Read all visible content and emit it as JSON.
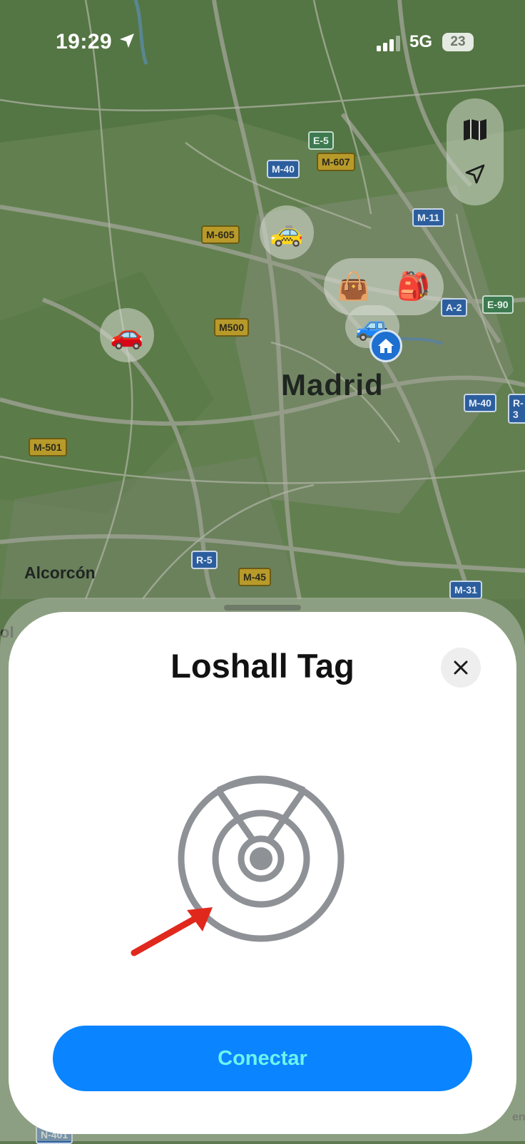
{
  "status_bar": {
    "time": "19:29",
    "network": "5G",
    "battery": "23",
    "location_icon": "location-arrow-icon",
    "signal_icon": "cellular-signal-icon"
  },
  "map": {
    "city_label": "Madrid",
    "town_label": "Alcorcón",
    "edge_labels": [
      "ol",
      "N-401",
      "R-3",
      "en"
    ],
    "road_labels": [
      "E-5",
      "M-40",
      "M-607",
      "M-605",
      "M-11",
      "A-2",
      "E-90",
      "M500",
      "M-40",
      "M-501",
      "R-5",
      "M-45",
      "M-31"
    ],
    "controls": {
      "map_mode_icon": "map-icon",
      "locate_icon": "location-arrow-icon"
    },
    "pins": [
      "taxi-emoji",
      "red-car-emoji",
      "handbag-emoji",
      "backpack-emoji",
      "blue-car-emoji"
    ],
    "home_icon": "home-icon"
  },
  "sheet": {
    "title": "Loshall Tag",
    "close_icon": "close-icon",
    "graphic": "airtag-target-icon",
    "button_label": "Conectar",
    "annotation": "red-arrow"
  },
  "colors": {
    "accent": "#0a84ff",
    "button_text": "#6df3ee",
    "map_green": "#5f7a52",
    "icon_gray": "#8e9196",
    "annotation": "#e1281c"
  }
}
